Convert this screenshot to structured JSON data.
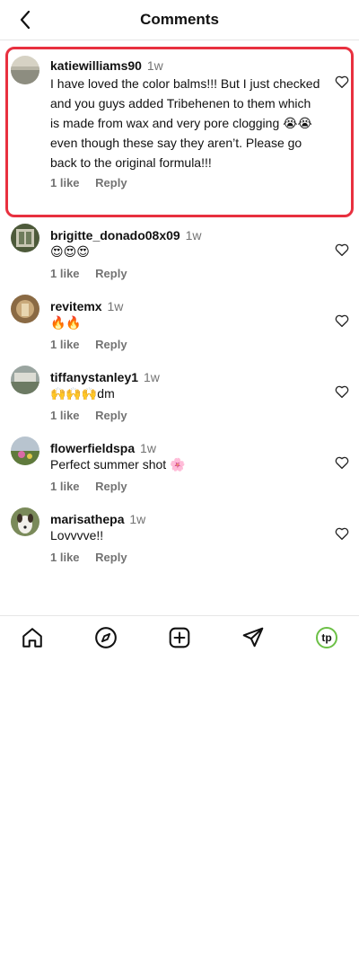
{
  "header": {
    "title": "Comments"
  },
  "comments": [
    {
      "username": "katiewilliams90",
      "time": "1w",
      "text": "I have loved the color balms!!! But I just checked and you guys added Tribehenen to them which is made from wax and very pore clogging 😭😭 even though these say they aren’t. Please go back to the original formula!!!",
      "likes": "1 like",
      "reply": "Reply"
    },
    {
      "username": "brigitte_donado08x09",
      "time": "1w",
      "text": "😍😍😍",
      "likes": "1 like",
      "reply": "Reply"
    },
    {
      "username": "revitemx",
      "time": "1w",
      "text": "🔥🔥",
      "likes": "1 like",
      "reply": "Reply"
    },
    {
      "username": "tiffanystanley1",
      "time": "1w",
      "text": "🙌🙌🙌dm",
      "likes": "1 like",
      "reply": "Reply"
    },
    {
      "username": "flowerfieldspa",
      "time": "1w",
      "text": "Perfect summer shot 🌸",
      "likes": "1 like",
      "reply": "Reply"
    },
    {
      "username": "marisathepa",
      "time": "1w",
      "text": "Lovvvve!!",
      "likes": "1 like",
      "reply": "Reply"
    }
  ],
  "nav": {
    "profile_initials": "tp"
  },
  "colors": {
    "highlight": "#e8303f",
    "profile_ring": "#6cc046",
    "muted": "#737373"
  }
}
